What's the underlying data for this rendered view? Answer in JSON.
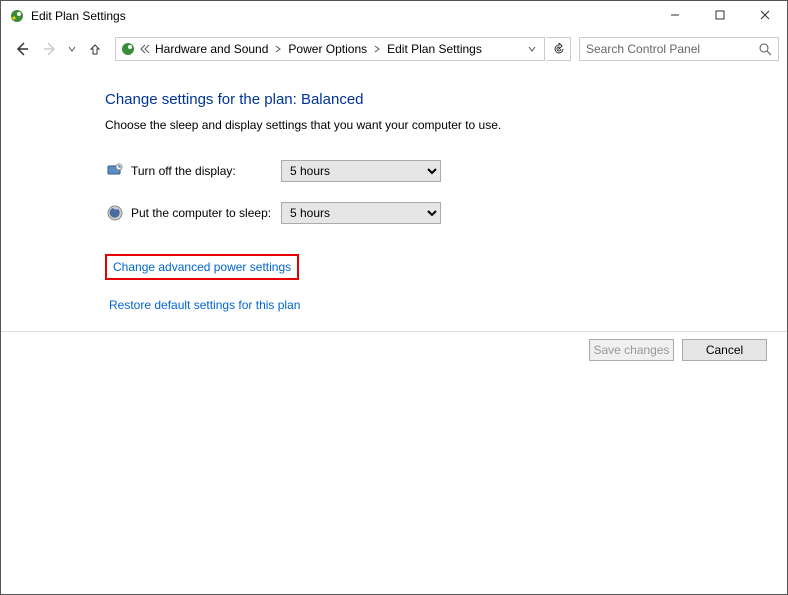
{
  "window": {
    "title": "Edit Plan Settings"
  },
  "breadcrumb": {
    "level1": "Hardware and Sound",
    "level2": "Power Options",
    "level3": "Edit Plan Settings"
  },
  "search": {
    "placeholder": "Search Control Panel"
  },
  "main": {
    "heading": "Change settings for the plan: Balanced",
    "subtext": "Choose the sleep and display settings that you want your computer to use.",
    "row1": {
      "label": "Turn off the display:",
      "value": "5 hours"
    },
    "row2": {
      "label": "Put the computer to sleep:",
      "value": "5 hours"
    },
    "link_advanced": "Change advanced power settings",
    "link_restore": "Restore default settings for this plan"
  },
  "buttons": {
    "save": "Save changes",
    "cancel": "Cancel"
  }
}
